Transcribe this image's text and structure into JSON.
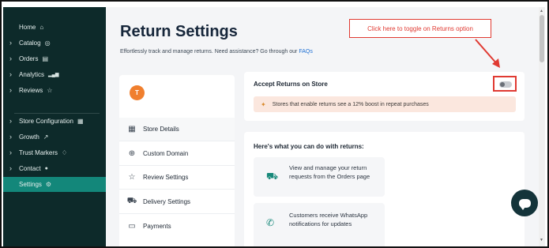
{
  "sidebar": {
    "items": [
      {
        "label": "Home",
        "icon": "home-icon",
        "glyph": "⌂"
      },
      {
        "label": "Catalog",
        "icon": "catalog-icon",
        "glyph": "◎"
      },
      {
        "label": "Orders",
        "icon": "orders-icon",
        "glyph": "▤"
      },
      {
        "label": "Analytics",
        "icon": "analytics-icon",
        "glyph": "▂▄▆"
      },
      {
        "label": "Reviews",
        "icon": "star-icon",
        "glyph": "☆"
      },
      {
        "label": "Store Configuration",
        "icon": "store-icon",
        "glyph": "▦"
      },
      {
        "label": "Growth",
        "icon": "trend-icon",
        "glyph": "↗"
      },
      {
        "label": "Trust Markers",
        "icon": "diamond-icon",
        "glyph": "♢"
      },
      {
        "label": "Contact",
        "icon": "chat-icon",
        "glyph": "●"
      },
      {
        "label": "Settings",
        "icon": "gear-icon",
        "glyph": "⚙"
      }
    ],
    "active_color": "#13877a",
    "background": "#0d2a2a"
  },
  "header": {
    "title": "Return Settings",
    "subtitle": "Effortlessly track and manage returns. Need assistance? Go through our ",
    "faq_link": "FAQs"
  },
  "settings_nav": {
    "avatar_letter": "T",
    "items": [
      {
        "label": "Store Details",
        "icon": "store-icon",
        "glyph": "▦"
      },
      {
        "label": "Custom Domain",
        "icon": "globe-icon",
        "glyph": "⊕"
      },
      {
        "label": "Review Settings",
        "icon": "star-icon",
        "glyph": "☆"
      },
      {
        "label": "Delivery Settings",
        "icon": "truck-icon",
        "glyph": "⛟"
      },
      {
        "label": "Payments",
        "icon": "payment-icon",
        "glyph": "▭"
      }
    ]
  },
  "accept_returns": {
    "title": "Accept Returns on Store",
    "toggle_on": false,
    "banner_text": "Stores that enable returns see a 12% boost in repeat purchases"
  },
  "can_do": {
    "title": "Here's what you can do with returns:",
    "features": [
      {
        "text": "View and manage your return requests from the Orders page",
        "icon": "return-truck-icon",
        "glyph": "⛟"
      },
      {
        "text": "Customers receive WhatsApp notifications for updates",
        "icon": "whatsapp-icon",
        "glyph": "✆"
      }
    ]
  },
  "annotation": {
    "callout_text": "Click here to toggle on Returns option",
    "color": "#e03a32"
  }
}
